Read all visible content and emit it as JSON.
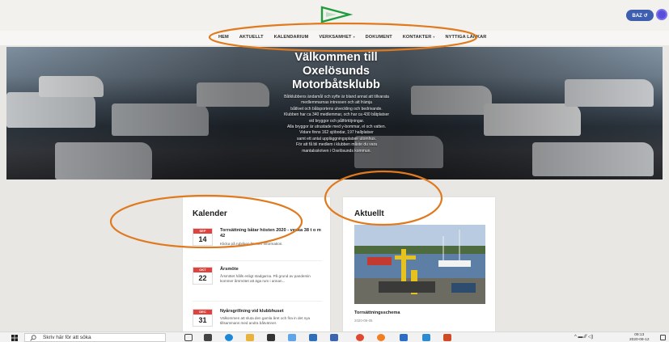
{
  "header": {
    "baz_label": "BAZ ↺",
    "brand_colors": {
      "logo": "#1e9c3c",
      "button": "#3e5fb0",
      "user": "#5a4fd8",
      "month_badge": "#e0423c",
      "annotation": "#e07a1f"
    }
  },
  "nav": {
    "items": [
      {
        "label": "HEM"
      },
      {
        "label": "AKTUELLT"
      },
      {
        "label": "KALENDARIUM"
      },
      {
        "label": "VERKSAMHET"
      },
      {
        "label": "DOKUMENT"
      },
      {
        "label": "KONTAKTER"
      },
      {
        "label": "NYTTIGA LÄNKAR"
      }
    ]
  },
  "hero": {
    "title_1": "Välkommen till",
    "title_2": "Oxelösunds",
    "title_3": "Motorbåtsklubb",
    "lines": [
      "Båtklubbens ändamål och syfte är bland annat att tillvarata",
      "medlemmarnas intressen och att främja",
      "båtlivet och båtsportens utveckling och bedrivande.",
      "Klubben har ca 340 medlemmar, och har ca 430 båtplatser",
      "vid bryggor och pålförtöjningar.",
      "Alla bryggor är utrustade med y-bommar, el och vatten.",
      "Vidare finns 162 sjöbodar, 197 hallplatser",
      "samt ett antal uppläggningsplatser utomhus.",
      "För att få bli medlem i klubben måste du vara",
      "mantalsskriven i Oxelösunds kommun."
    ]
  },
  "kalender": {
    "title": "Kalender",
    "events": [
      {
        "month": "SEP",
        "day": "14",
        "title": "Torrsättning båtar hösten 2020 - vecka 38 t o m 42",
        "desc": "Klicka på rubriken för mer information."
      },
      {
        "month": "OKT",
        "day": "22",
        "title": "Årsmöte",
        "desc": "Årsmötet hålls enligt stadgarna. På grund av pandemin kommer årsmötet att äga rum i annan..."
      },
      {
        "month": "DEC",
        "day": "31",
        "title": "Nyårsgrillning vid klubbhuset",
        "desc": "Välkommen att sluta den gamla året och fira in det nya tillsammans med andra båtvänner."
      }
    ]
  },
  "aktuellt": {
    "title": "Aktuellt",
    "news_title": "Torrsättningsschema",
    "news_date": "2020-09-05"
  },
  "taskbar": {
    "search_placeholder": "Skriv här för att söka",
    "time": "09:13",
    "date": "2020-09-12",
    "tray_text": "^ ▬ ⁄⁄⁄ ◁)"
  }
}
